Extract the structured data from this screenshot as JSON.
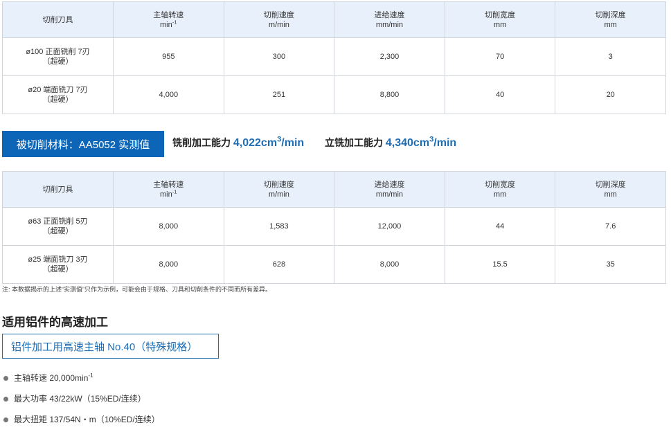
{
  "table1": {
    "headers": [
      {
        "line1": "切削刀具",
        "line2": ""
      },
      {
        "line1": "主轴转速",
        "line2": "min",
        "sup": "-1"
      },
      {
        "line1": "切削速度",
        "line2": "m/min"
      },
      {
        "line1": "进给速度",
        "line2": "mm/min"
      },
      {
        "line1": "切削宽度",
        "line2": "mm"
      },
      {
        "line1": "切削深度",
        "line2": "mm"
      }
    ],
    "rows": [
      {
        "tool_line1": "ø100 正面铣削 7刃",
        "tool_line2": "（超硬）",
        "rpm": "955",
        "speed": "300",
        "feed": "2,300",
        "width": "70",
        "depth": "3"
      },
      {
        "tool_line1": "ø20 端面铣刀 7刃",
        "tool_line2": "（超硬）",
        "rpm": "4,000",
        "speed": "251",
        "feed": "8,800",
        "width": "40",
        "depth": "20"
      }
    ]
  },
  "banner": {
    "material": "被切削材料：AA5052 实测值",
    "milling_label": "铣削加工能力",
    "milling_value": "4,022cm",
    "milling_sup": "3",
    "milling_unit": "/min",
    "end_label": "立铣加工能力",
    "end_value": "4,340cm",
    "end_sup": "3",
    "end_unit": "/min"
  },
  "table2": {
    "headers": [
      {
        "line1": "切削刀具",
        "line2": ""
      },
      {
        "line1": "主轴转速",
        "line2": "min",
        "sup": "-1"
      },
      {
        "line1": "切削速度",
        "line2": "m/min"
      },
      {
        "line1": "进给速度",
        "line2": "mm/min"
      },
      {
        "line1": "切削宽度",
        "line2": "mm"
      },
      {
        "line1": "切削深度",
        "line2": "mm"
      }
    ],
    "rows": [
      {
        "tool_line1": "ø63 正面铣削 5刃",
        "tool_line2": "（超硬）",
        "rpm": "8,000",
        "speed": "1,583",
        "feed": "12,000",
        "width": "44",
        "depth": "7.6"
      },
      {
        "tool_line1": "ø25 端面铣刀 3刃",
        "tool_line2": "（超硬）",
        "rpm": "8,000",
        "speed": "628",
        "feed": "8,000",
        "width": "15.5",
        "depth": "35"
      }
    ]
  },
  "note": "注: 本数据揭示的上述“实测值”只作为示例，可能会由于规格、刀具和切削条件的不同而所有差异。",
  "section": {
    "title": "适用铝件的高速加工",
    "spindle": "铝件加工用高速主轴 No.40（特殊规格）",
    "specs": [
      {
        "text": "主轴转速 20,000min",
        "sup": "-1"
      },
      {
        "text": "最大功率 43/22kW（15%ED/连续）"
      },
      {
        "text": "最大扭矩 137/54N・m（10%ED/连续）"
      }
    ]
  },
  "colors": {
    "accent": "#0d65b8",
    "header_bg": "#e8f1fb",
    "border": "#d0d5dc",
    "value_blue": "#1d6db5"
  }
}
